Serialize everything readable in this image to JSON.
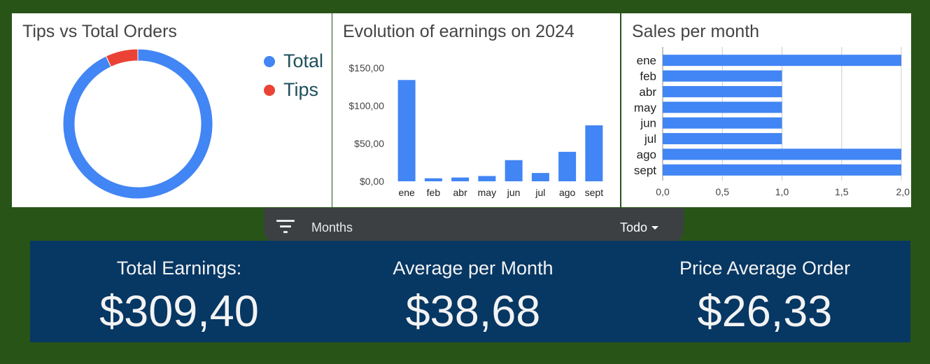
{
  "colors": {
    "background": "#295418",
    "series_blue": "#4285f4",
    "series_red": "#ea4335",
    "kpi_background": "#073763"
  },
  "donut_chart": {
    "title": "Tips vs Total Orders",
    "legend": [
      {
        "label": "Total",
        "color": "#4285f4"
      },
      {
        "label": "Tips",
        "color": "#ea4335"
      }
    ]
  },
  "bar_chart": {
    "title": "Evolution of earnings on 2024",
    "y_ticks": [
      "$150,00",
      "$100,00",
      "$50,00",
      "$0,00"
    ]
  },
  "hbar_chart": {
    "title": "Sales per month",
    "x_ticks": [
      "0,0",
      "0,5",
      "1,0",
      "1,5",
      "2,0"
    ]
  },
  "chart_data": [
    {
      "type": "pie",
      "title": "Tips vs Total Orders",
      "donut": true,
      "slices": [
        {
          "label": "Total",
          "value": 93
        },
        {
          "label": "Tips",
          "value": 7
        }
      ],
      "legend": "right"
    },
    {
      "type": "bar",
      "title": "Evolution of earnings on 2024",
      "categories": [
        "ene",
        "feb",
        "abr",
        "may",
        "jun",
        "jul",
        "ago",
        "sept"
      ],
      "values": [
        134,
        4,
        5,
        7,
        28,
        11,
        39,
        74
      ],
      "ylim": [
        0,
        150
      ],
      "grid": false
    },
    {
      "type": "bar",
      "orientation": "horizontal",
      "title": "Sales per month",
      "categories": [
        "ene",
        "feb",
        "abr",
        "may",
        "jun",
        "jul",
        "ago",
        "sept"
      ],
      "values": [
        2,
        1,
        1,
        1,
        1,
        1,
        2,
        2
      ],
      "xlim": [
        0,
        2
      ],
      "grid": true
    }
  ],
  "filter": {
    "label": "Months",
    "value": "Todo"
  },
  "kpis": [
    {
      "label": "Total Earnings:",
      "value": "$309,40"
    },
    {
      "label": "Average per Month",
      "value": "$38,68"
    },
    {
      "label": "Price Average Order",
      "value": "$26,33"
    }
  ]
}
